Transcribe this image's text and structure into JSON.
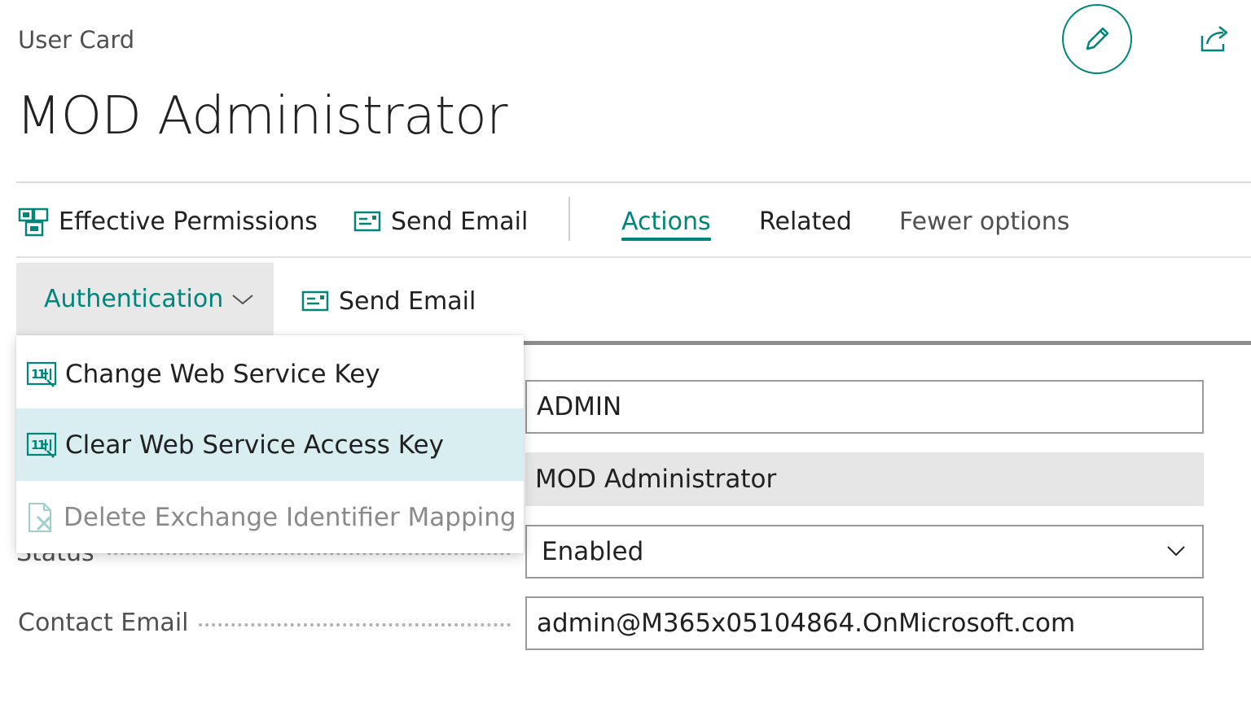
{
  "header": {
    "caption": "User Card",
    "title": "MOD Administrator"
  },
  "actionbar": {
    "effective_permissions": "Effective Permissions",
    "send_email": "Send Email",
    "tab_actions": "Actions",
    "tab_related": "Related",
    "fewer_options": "Fewer options"
  },
  "subbar": {
    "authentication": "Authentication",
    "send_email": "Send Email"
  },
  "menu": {
    "items": [
      {
        "label": "Change Web Service Key"
      },
      {
        "label": "Clear Web Service Access Key"
      },
      {
        "label": "Delete Exchange Identifier Mapping"
      }
    ]
  },
  "form": {
    "user_name": "ADMIN",
    "full_name": "MOD Administrator",
    "status_label": "Status",
    "status_value": "Enabled",
    "contact_email_label": "Contact Email",
    "contact_email": "admin@M365x05104864.OnMicrosoft.com"
  },
  "colors": {
    "accent": "#00857a",
    "highlight": "#d9eef0",
    "readonly_bg": "#e6e6e6"
  },
  "icons": [
    "edit-pencil-icon",
    "share-icon",
    "permissions-icon",
    "email-icon",
    "chevron-down-icon",
    "web-service-key-icon",
    "delete-mapping-icon"
  ]
}
